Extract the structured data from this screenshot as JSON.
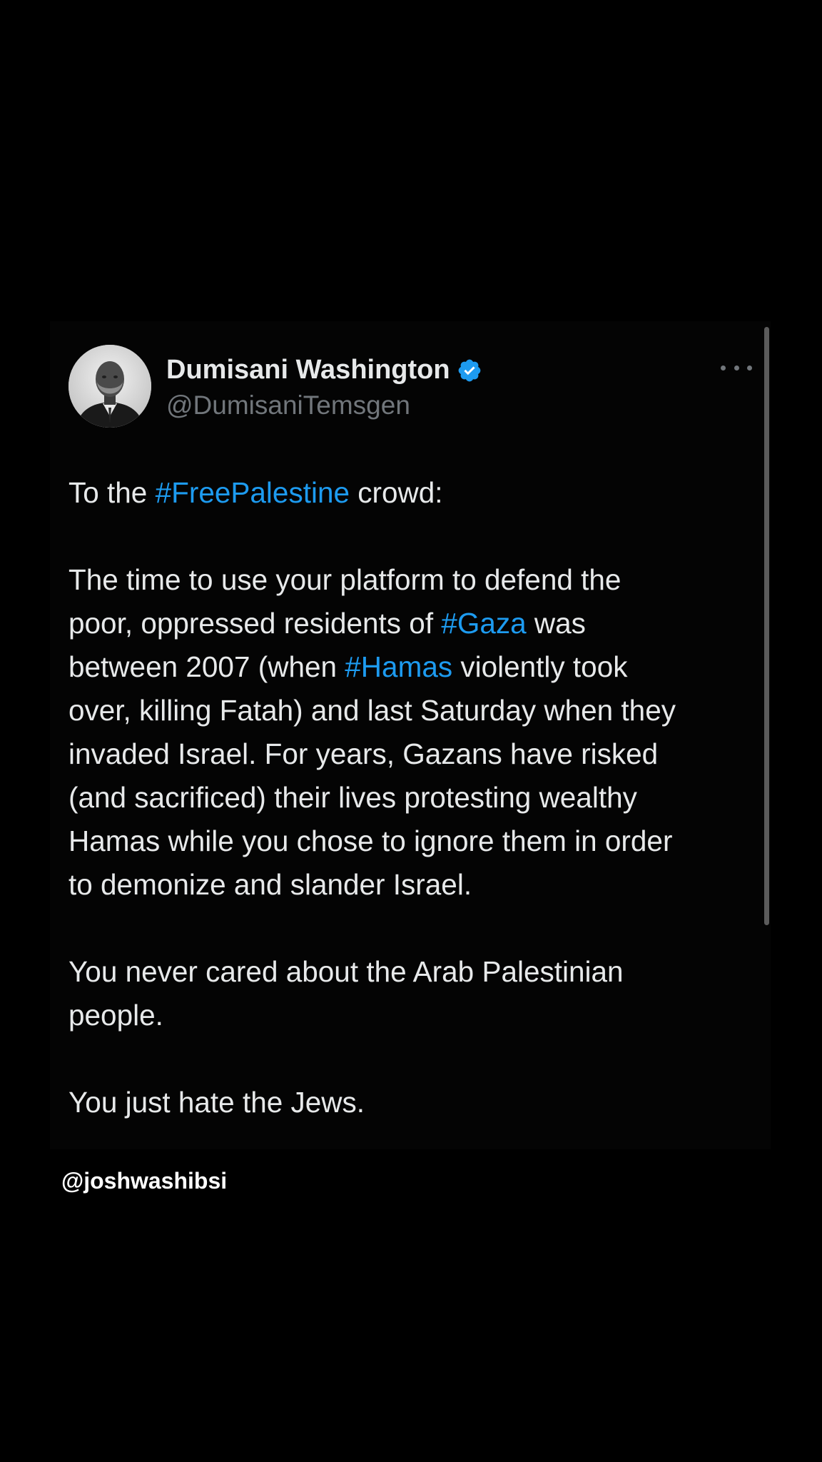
{
  "tweet": {
    "author": {
      "display_name": "Dumisani Washington",
      "handle": "@DumisaniTemsgen",
      "verified": true,
      "verified_badge_color": "#1d9bf0",
      "avatar_icon": "profile-photo-man-in-suit"
    },
    "more_button_icon": "more-horizontal-icon",
    "intro": {
      "before": "To the ",
      "hashtag": "#FreePalestine",
      "after": " crowd:"
    },
    "paragraph_2": {
      "l1": "The time to use your platform to defend the",
      "l2_before": "poor, oppressed residents of ",
      "l2_hashtag": "#Gaza",
      "l2_after": " was",
      "l3_before": "between 2007 (when ",
      "l3_hashtag": "#Hamas",
      "l3_after": " violently took",
      "l4": "over, killing Fatah) and last Saturday when they",
      "l5": "invaded Israel. For years, Gazans have risked",
      "l6": "(and sacrificed) their lives protesting wealthy",
      "l7": "Hamas while you chose to ignore them in order",
      "l8": "to demonize and slander Israel."
    },
    "paragraph_3": {
      "l1": "You never cared about the Arab Palestinian",
      "l2": "people."
    },
    "paragraph_4": {
      "l1": "You just hate the Jews."
    }
  },
  "watermark": "@joshwashibsi",
  "colors": {
    "background": "#000000",
    "text_primary": "#e7e9ea",
    "text_secondary": "#71767b",
    "hashtag": "#1d9bf0"
  }
}
